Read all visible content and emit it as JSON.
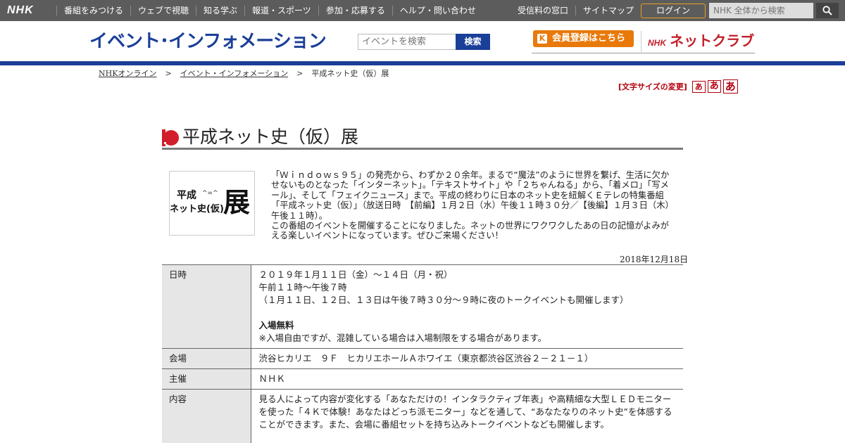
{
  "topbar": {
    "logo": "NHK",
    "nav": [
      "番組をみつける",
      "ウェブで視聴",
      "知る学ぶ",
      "報道・スポーツ",
      "参加・応募する",
      "ヘルプ・問い合わせ"
    ],
    "right_links": [
      "受信料の窓口",
      "サイトマップ"
    ],
    "login_label": "ログイン",
    "search_placeholder": "NHK 全体から検索"
  },
  "header": {
    "site_title": "イベント･インフォメーション",
    "search_placeholder": "イベントを検索",
    "search_button": "検索",
    "member_button": "会員登録はこちら",
    "member_icon": "K",
    "netclub_prefix": "NHK",
    "netclub_label": "ネットクラブ"
  },
  "breadcrumb": [
    "NHKオンライン",
    "イベント・インフォメーション",
    "平成ネット史（仮）展"
  ],
  "breadcrumb_sep": ">",
  "fontsize": {
    "label": "[文字サイズの変更]",
    "small": "あ",
    "medium": "あ",
    "large": "あ"
  },
  "page": {
    "title": "平成ネット史（仮）展",
    "thumb_line1": "平成",
    "thumb_line2": "ネット史(仮)",
    "thumb_big": "展",
    "thumb_cat": "^=^",
    "intro_p1": "「Ｗｉｎｄｏｗｓ９５」の発売から、わずか２０余年。まるで“魔法”のように世界を繋げ、生活に欠かせないものとなった「インターネット」。「テキストサイト」や「２ちゃんねる」から、「着メロ」「写メール」、そして「フェイクニュース」まで。平成の終わりに日本のネット史を紐解くＥテレの特集番組「平成ネット史（仮）」（放送日時　【前編】１月２日（水）午後１１時３０分／【後編】１月３日（木）午後１１時）。",
    "intro_p2": "この番組のイベントを開催することになりました。ネットの世界にワクワクしたあの日の記憶がよみがえる楽しいイベントになっています。ぜひご来場ください！",
    "date": "2018年12月18日"
  },
  "info": {
    "time_label": "日時",
    "time_line1": "２０１９年１月１１日（金）～１４日（月・祝）",
    "time_line2": "午前１１時～午後７時",
    "time_line3": "（１月１１日、１２日、１３日は午後７時３０分～９時に夜のトークイベントも開催します）",
    "time_free": "入場無料",
    "time_note": "※入場自由ですが、混雑している場合は入場制限をする場合があります。",
    "venue_label": "会場",
    "venue": "渋谷ヒカリエ　９Ｆ　ヒカリエホールＡホワイエ（東京都渋谷区渋谷２－２１－１）",
    "org_label": "主催",
    "org": "ＮＨＫ",
    "content_label": "内容",
    "content": "見る人によって内容が変化する「あなただけの！インタラクティブ年表」や高精細な大型ＬＥＤモニターを使った「４Ｋで体験！あなたはどっち派モニター」などを通して、“あなたなりのネット史”を体感することができます。また、会場に番組セットを持ち込みトークイベントなども開催します。"
  },
  "colors": {
    "nhk_blue": "#1a3f99",
    "topbar_gray": "#5c5c5c",
    "accent_orange": "#e8790a",
    "fontsize_red": "#b3000c",
    "title_red": "#d21d2a"
  },
  "icons": {
    "search": "search-icon",
    "title_marker": "red-circle-icon"
  }
}
